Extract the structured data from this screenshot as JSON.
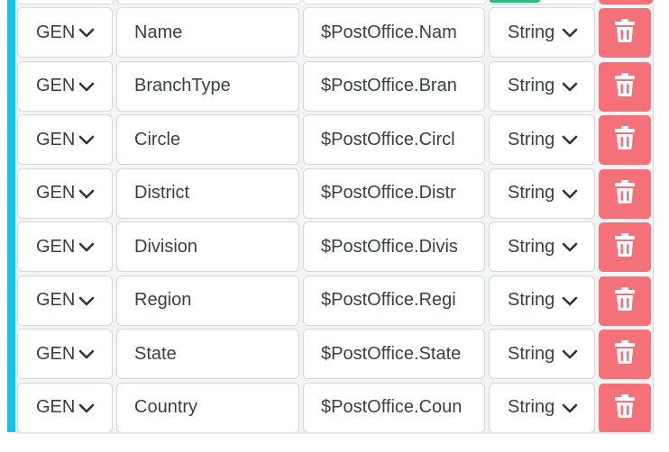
{
  "rows": [
    {
      "gen": "GEN",
      "name": "Name",
      "path": "$PostOffice.Nam",
      "type": "String"
    },
    {
      "gen": "GEN",
      "name": "BranchType",
      "path": "$PostOffice.Bran",
      "type": "String"
    },
    {
      "gen": "GEN",
      "name": "Circle",
      "path": "$PostOffice.Circl",
      "type": "String"
    },
    {
      "gen": "GEN",
      "name": "District",
      "path": "$PostOffice.Distr",
      "type": "String"
    },
    {
      "gen": "GEN",
      "name": "Division",
      "path": "$PostOffice.Divis",
      "type": "String"
    },
    {
      "gen": "GEN",
      "name": "Region",
      "path": "$PostOffice.Regi",
      "type": "String"
    },
    {
      "gen": "GEN",
      "name": "State",
      "path": "$PostOffice.State",
      "type": "String"
    },
    {
      "gen": "GEN",
      "name": "Country",
      "path": "$PostOffice.Coun",
      "type": "String"
    }
  ],
  "icons": {
    "dropdown": "chevron-down-icon",
    "delete": "trash-icon"
  },
  "colors": {
    "accent_bar": "#1cc0e0",
    "delete_button": "#f47179",
    "status_green": "#2bbf7b"
  }
}
